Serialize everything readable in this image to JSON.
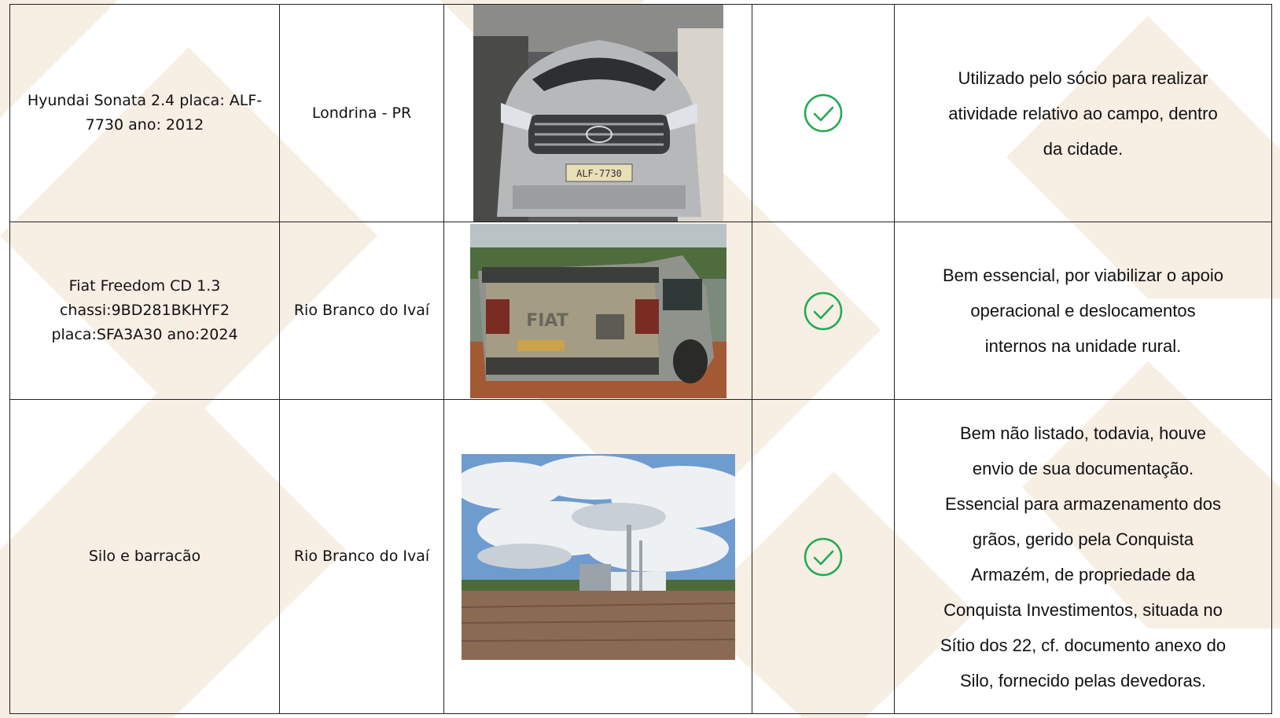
{
  "colors": {
    "border": "#222222",
    "check_green": "#1faa4f",
    "watermark": "#f6ece0"
  },
  "rows": [
    {
      "description_lines": [
        "Hyundai Sonata 2.4 placa: ALF-",
        "7730 ano: 2012"
      ],
      "location": "Londrina - PR",
      "photo": {
        "subject": "silver sedan front view",
        "plate_text": "ALF-7730"
      },
      "status_icon": "check-circle-icon",
      "note_lines": [
        "Utilizado pelo sócio para realizar",
        "atividade relativo ao campo, dentro",
        "da cidade."
      ]
    },
    {
      "description_lines": [
        "Fiat Freedom CD 1.3",
        "chassi:9BD281BKHYF2",
        "placa:SFA3A30 ano:2024"
      ],
      "location": "Rio Branco do Ivaí",
      "photo": {
        "subject": "pickup truck rear view",
        "brand_text": "FIAT"
      },
      "status_icon": "check-circle-icon",
      "note_lines": [
        "Bem essencial, por viabilizar o apoio",
        "operacional e deslocamentos",
        "internos na unidade rural."
      ]
    },
    {
      "description_lines": [
        "Silo e barracão"
      ],
      "location": "Rio Branco do Ivaí",
      "photo": {
        "subject": "grain silo and warehouse under cloudy sky"
      },
      "status_icon": "check-circle-icon",
      "note_lines": [
        "Bem não listado, todavia, houve",
        "envio de sua documentação.",
        "Essencial para armazenamento dos",
        "grãos, gerido pela Conquista",
        "Armazém, de propriedade da",
        "Conquista Investimentos, situada no",
        "Sítio dos 22, cf. documento anexo do",
        "Silo, fornecido pelas devedoras."
      ]
    }
  ]
}
